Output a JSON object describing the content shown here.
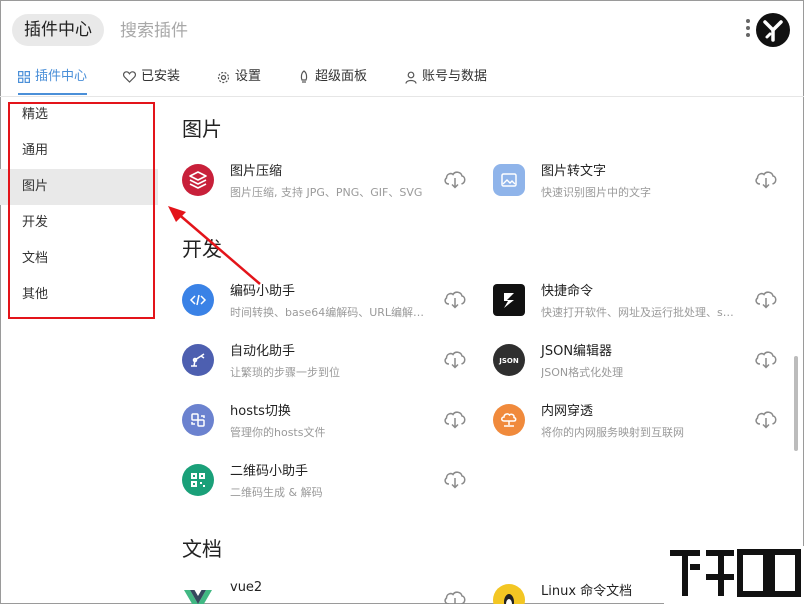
{
  "header": {
    "title": "插件中心",
    "search_placeholder": "搜索插件"
  },
  "tabs": [
    {
      "label": "插件中心",
      "icon": "grid-icon",
      "active": true
    },
    {
      "label": "已安装",
      "icon": "heart-icon"
    },
    {
      "label": "设置",
      "icon": "gear-icon"
    },
    {
      "label": "超级面板",
      "icon": "rocket-icon"
    },
    {
      "label": "账号与数据",
      "icon": "user-icon"
    }
  ],
  "sidebar": {
    "items": [
      {
        "label": "精选"
      },
      {
        "label": "通用"
      },
      {
        "label": "图片",
        "active": true
      },
      {
        "label": "开发"
      },
      {
        "label": "文档"
      },
      {
        "label": "其他"
      }
    ]
  },
  "sections": {
    "images": {
      "title": "图片",
      "plugins": [
        {
          "name": "图片压缩",
          "desc": "图片压缩, 支持 JPG、PNG、GIF、SVG",
          "color": "#c8203a"
        },
        {
          "name": "图片转文字",
          "desc": "快速识别图片中的文字",
          "color": "#8fb4ea"
        }
      ]
    },
    "dev": {
      "title": "开发",
      "plugins": [
        {
          "name": "编码小助手",
          "desc": "时间转换、base64编解码、URL编解…",
          "color": "#3a82e6"
        },
        {
          "name": "快捷命令",
          "desc": "快速打开软件、网址及运行批处理、s…",
          "color": "#111111"
        },
        {
          "name": "自动化助手",
          "desc": "让繁琐的步骤一步到位",
          "color": "#4d5fb0"
        },
        {
          "name": "JSON编辑器",
          "desc": "JSON格式化处理",
          "color": "#2f2f2f"
        },
        {
          "name": "hosts切换",
          "desc": "管理你的hosts文件",
          "color": "#6b82cf"
        },
        {
          "name": "内网穿透",
          "desc": "将你的内网服务映射到互联网",
          "color": "#f08a3c"
        },
        {
          "name": "二维码小助手",
          "desc": "二维码生成 & 解码",
          "color": "#1aa079"
        }
      ]
    },
    "docs": {
      "title": "文档",
      "plugins": [
        {
          "name": "vue2",
          "color": "#41b883"
        },
        {
          "name": "Linux 命令文档",
          "color": "#f3c623"
        }
      ]
    }
  },
  "colors": {
    "accent": "#4a8fd8",
    "annotation": "#e3141a"
  }
}
